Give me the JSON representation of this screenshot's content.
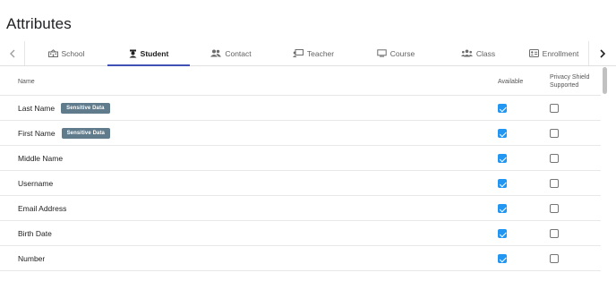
{
  "page": {
    "title": "Attributes"
  },
  "tabs": [
    {
      "label": "School",
      "icon": "school-icon",
      "active": false
    },
    {
      "label": "Student",
      "icon": "student-icon",
      "active": true
    },
    {
      "label": "Contact",
      "icon": "contact-icon",
      "active": false
    },
    {
      "label": "Teacher",
      "icon": "teacher-icon",
      "active": false
    },
    {
      "label": "Course",
      "icon": "course-icon",
      "active": false
    },
    {
      "label": "Class",
      "icon": "class-icon",
      "active": false
    },
    {
      "label": "Enrollment",
      "icon": "enrollment-icon",
      "active": false
    }
  ],
  "table": {
    "headers": {
      "name": "Name",
      "available": "Available",
      "privacy": "Privacy Shield Supported"
    },
    "rows": [
      {
        "name": "Last Name",
        "badge": "Sensitive Data",
        "available": true,
        "privacy": false
      },
      {
        "name": "First Name",
        "badge": "Sensitive Data",
        "available": true,
        "privacy": false
      },
      {
        "name": "Middle Name",
        "badge": "",
        "available": true,
        "privacy": false
      },
      {
        "name": "Username",
        "badge": "",
        "available": true,
        "privacy": false
      },
      {
        "name": "Email Address",
        "badge": "",
        "available": true,
        "privacy": false
      },
      {
        "name": "Birth Date",
        "badge": "",
        "available": true,
        "privacy": false
      },
      {
        "name": "Number",
        "badge": "",
        "available": true,
        "privacy": false
      }
    ]
  },
  "colors": {
    "accent": "#3f51b5",
    "checkbox": "#2196f3",
    "badge": "#5f7b8c"
  }
}
